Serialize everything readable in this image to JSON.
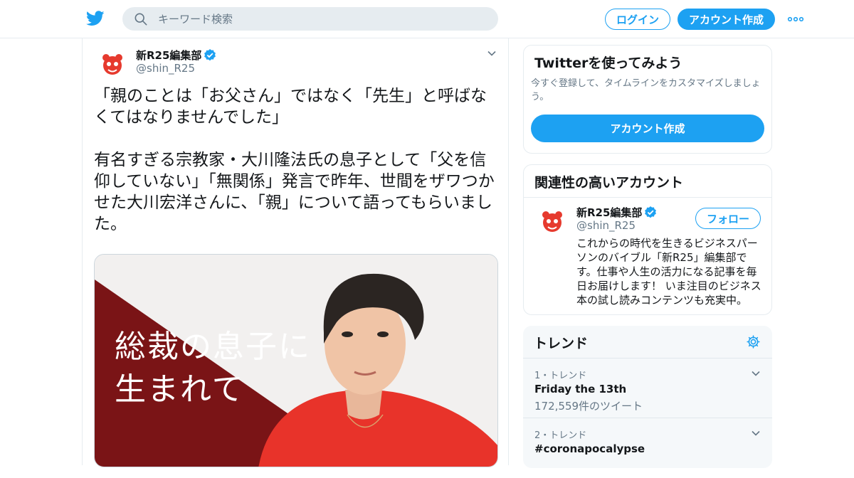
{
  "header": {
    "search_placeholder": "キーワード検索",
    "login_label": "ログイン",
    "signup_label": "アカウント作成"
  },
  "tweet": {
    "author_name": "新R25編集部",
    "author_handle": "@shin_R25",
    "text": "「親のことは「お父さん」ではなく「先生」と呼ばなくてはなりませんでした」\n\n有名すぎる宗教家・大川隆法氏の息子として「父を信仰していない」「無関係」発言で昨年、世間をザワつかせた大川宏洋さんに、「親」について語ってもらいました。",
    "media_title": "総裁の息子に\n生まれて"
  },
  "sidebar": {
    "signup_card": {
      "title": "Twitterを使ってみよう",
      "subtitle": "今すぐ登録して、タイムラインをカスタマイズしましょう。",
      "button_label": "アカウント作成"
    },
    "related": {
      "title": "関連性の高いアカウント",
      "account_name": "新R25編集部",
      "account_handle": "@shin_R25",
      "follow_label": "フォロー",
      "bio": "これからの時代を生きるビジネスパーソンのバイブル「新R25」編集部です。仕事や人生の活力になる記事を毎日お届けします！ いま注目のビジネス本の試し読みコンテンツも充実中。"
    },
    "trends": {
      "title": "トレンド",
      "items": [
        {
          "rank": "1・トレンド",
          "name": "Friday the 13th",
          "count": "172,559件のツイート"
        },
        {
          "rank": "2・トレンド",
          "name": "#coronapocalypse",
          "count": ""
        }
      ]
    }
  },
  "colors": {
    "brand_blue": "#1da1f2",
    "text_primary": "#14171a",
    "text_secondary": "#657786",
    "media_red": "#7a1416",
    "shirt_red": "#e8332a"
  }
}
